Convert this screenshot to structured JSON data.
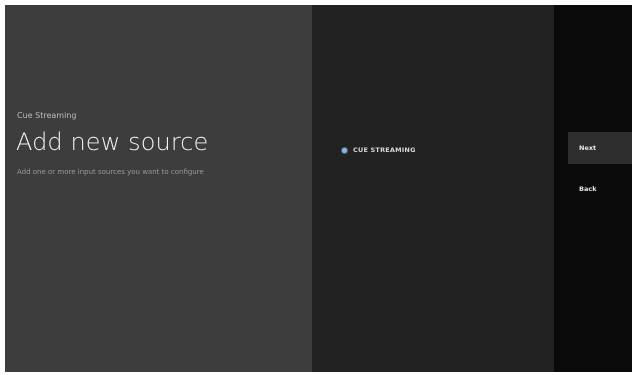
{
  "guidance": {
    "breadcrumb": "Cue Streaming",
    "title": "Add new source",
    "description": "Add one or more input sources you want to configure"
  },
  "sources": {
    "items": [
      {
        "label": "CUE STREAMING",
        "selected": true
      }
    ]
  },
  "actions": {
    "next_label": "Next",
    "back_label": "Back"
  },
  "colors": {
    "guidance_bg": "#3d3d3d",
    "list_bg": "#222222",
    "actions_bg": "#0a0a0a",
    "radio_accent": "#8fb4d9"
  }
}
